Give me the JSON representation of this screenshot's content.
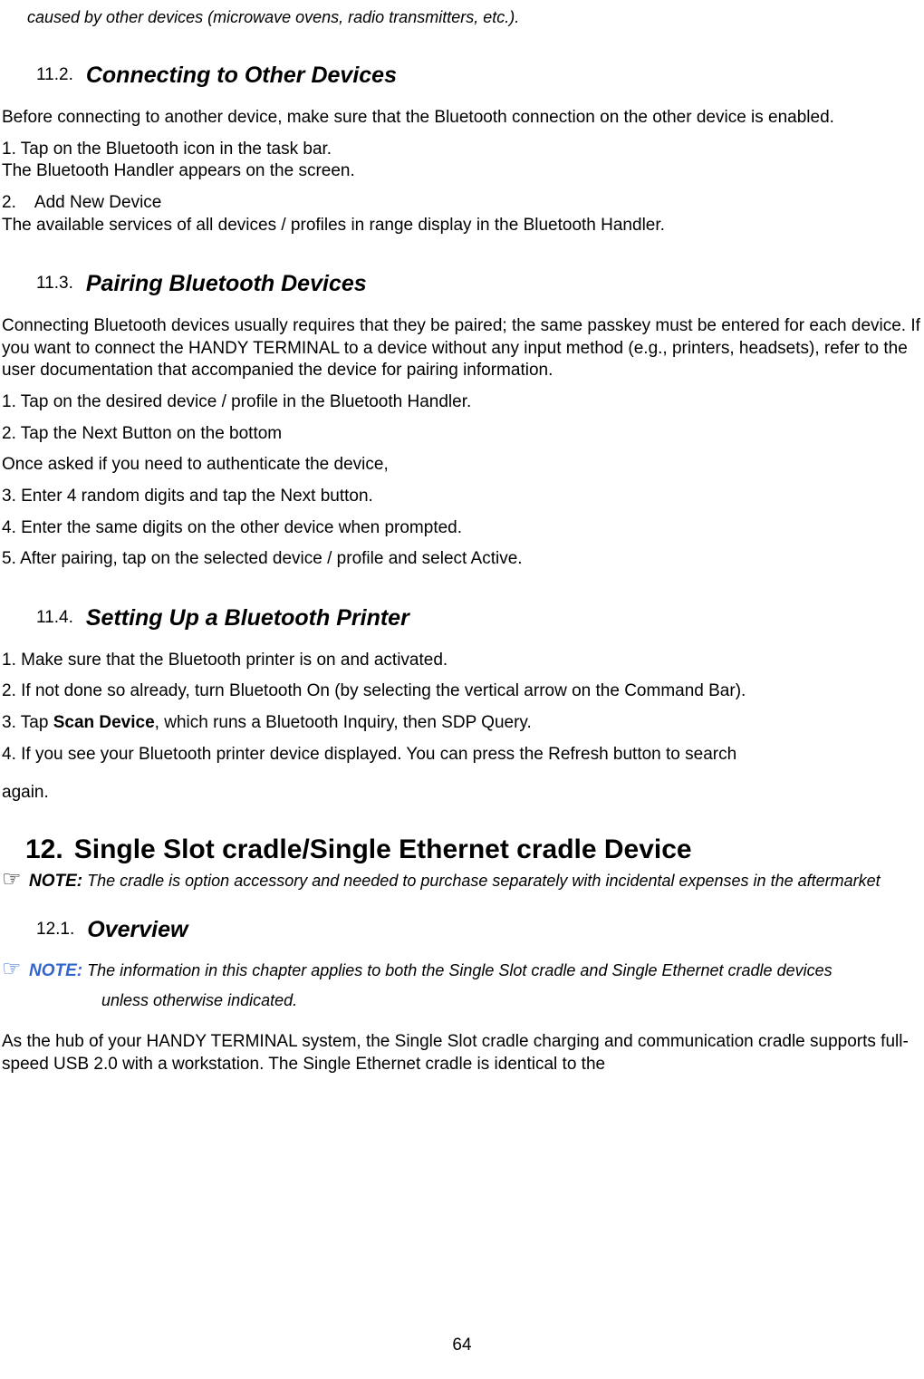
{
  "top_note": {
    "text": "caused by other devices (microwave ovens, radio transmitters, etc.)."
  },
  "s11_2": {
    "num": "11.2.",
    "title": "Connecting to Other Devices",
    "p1": "Before connecting to another device, make sure that the Bluetooth connection on the other device is enabled.",
    "p2a": "1. Tap on the Bluetooth icon in the task bar.",
    "p2b": "The Bluetooth Handler appears on the screen.",
    "p3a": "2.    Add New Device",
    "p3b": "The available services of all devices / profiles in range display in the Bluetooth Handler."
  },
  "s11_3": {
    "num": "11.3.",
    "title": "Pairing Bluetooth Devices",
    "p1": "Connecting Bluetooth devices usually requires that they be paired; the same passkey must be entered for each device. If you want to connect the HANDY TERMINAL to a device without any input method (e.g., printers, headsets), refer to the user documentation that accompanied the device for pairing information.",
    "p2": "1. Tap on the desired device / profile in the Bluetooth Handler.",
    "p3": "2. Tap the Next Button on the bottom",
    "p4": "Once asked if you need to authenticate the device,",
    "p5": "3. Enter 4 random digits and tap the Next button.",
    "p6": "4. Enter the same digits on the other device when prompted.",
    "p7": "5. After pairing, tap on the selected device / profile and select Active."
  },
  "s11_4": {
    "num": "11.4.",
    "title": "Setting Up a Bluetooth Printer",
    "p1": "1. Make sure that the Bluetooth printer is on and activated.",
    "p2": "2. If not done so already, turn Bluetooth On (by selecting the vertical arrow on the Command Bar).",
    "p3a": "3. Tap ",
    "p3b": "Scan Device",
    "p3c": ", which runs a Bluetooth Inquiry, then SDP Query.",
    "p4": "4. If you see your Bluetooth printer device displayed. You can press the Refresh button to search",
    "p5": "again."
  },
  "s12": {
    "num": "12.",
    "title": "Single Slot cradle/Single Ethernet cradle Device",
    "note_label": "NOTE:",
    "note_text": " The cradle is option accessory and needed to purchase separately with incidental expenses in the aftermarket"
  },
  "s12_1": {
    "num": "12.1.",
    "title": "Overview",
    "note_label": "NOTE:",
    "note_text_1": " The information in this chapter applies to both the Single Slot cradle and Single Ethernet cradle devices",
    "note_text_2": "unless otherwise indicated.",
    "p1": "As the hub of your HANDY TERMINAL system, the Single Slot cradle charging and communication cradle supports full-speed USB 2.0 with a workstation. The Single Ethernet cradle is identical to the"
  },
  "page_number": "64"
}
